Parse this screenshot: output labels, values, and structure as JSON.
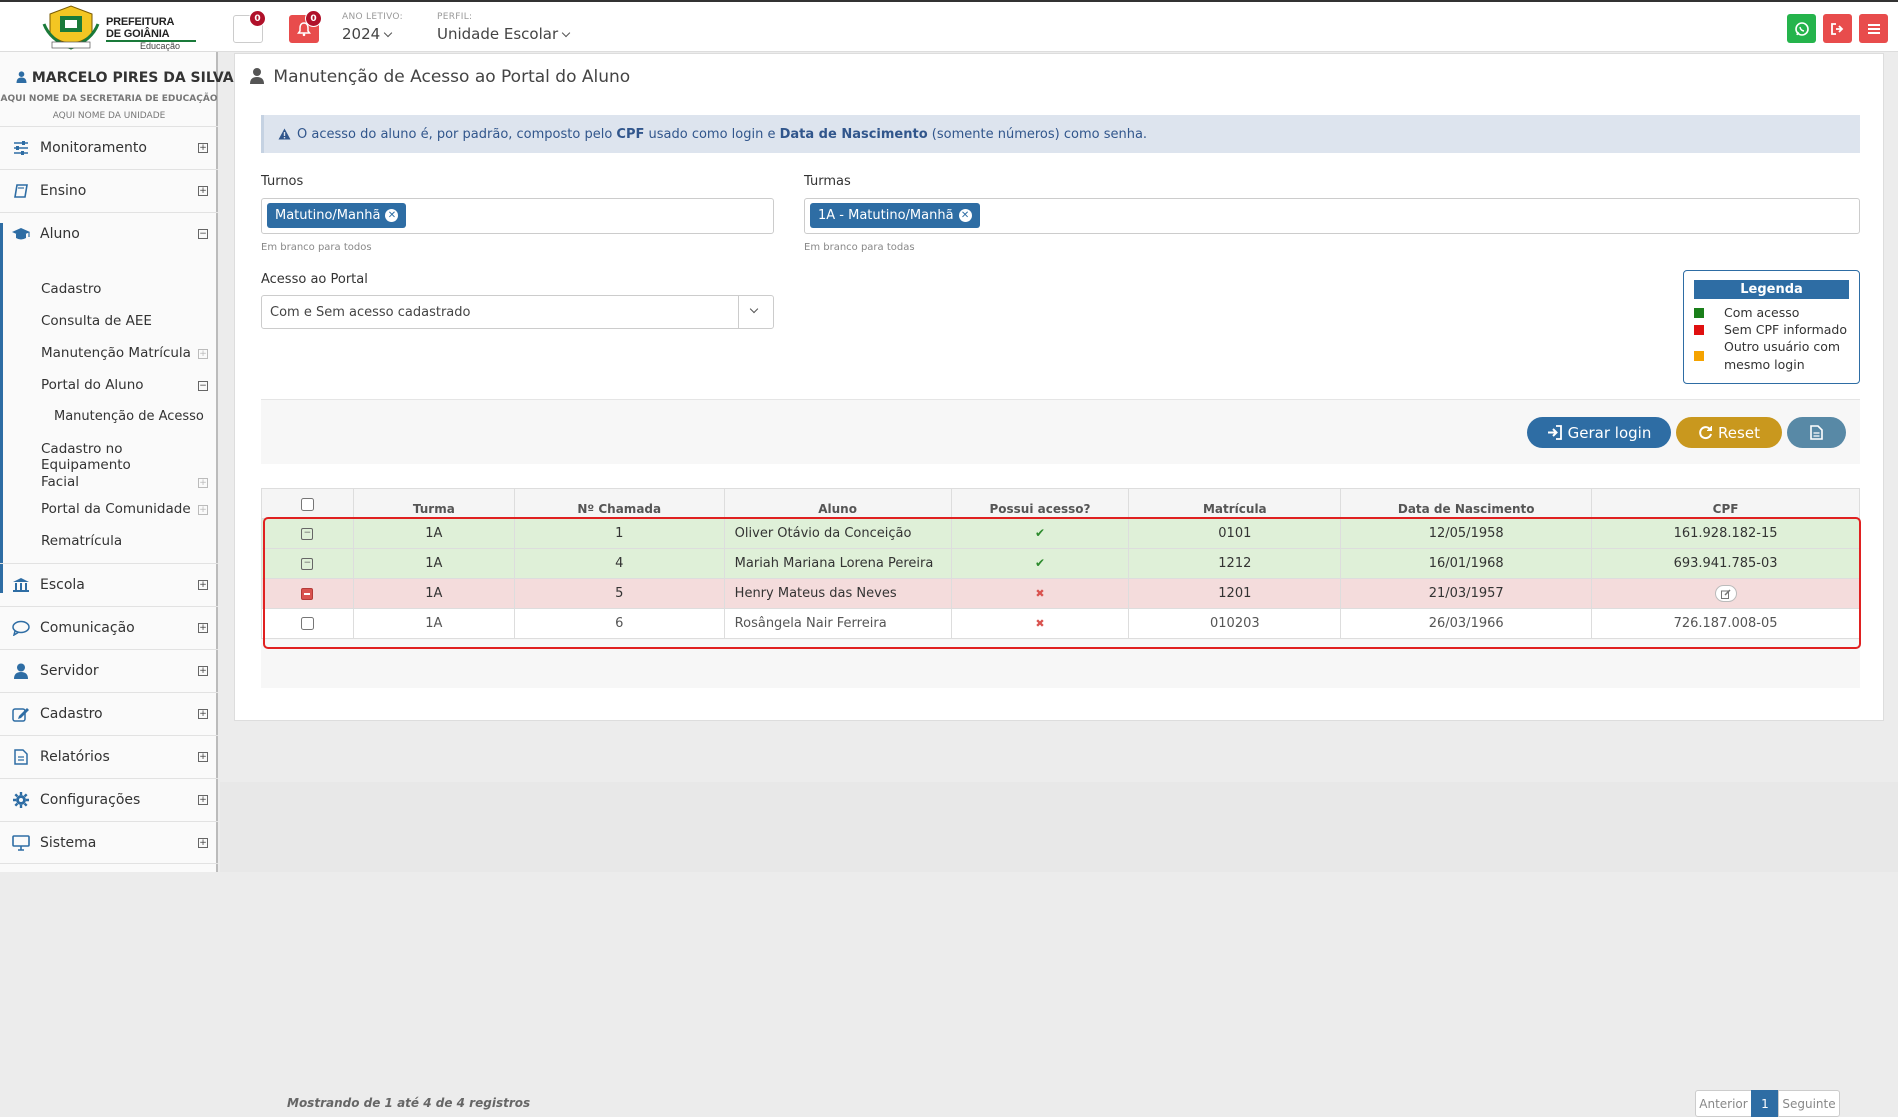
{
  "header": {
    "logo_line1": "PREFEITURA",
    "logo_line2": "DE GOIÂNIA",
    "logo_line3": "Educação",
    "notifications_count": "0",
    "alerts_count": "0",
    "ano_label": "ANO LETIVO:",
    "ano_value": "2024",
    "perfil_label": "PERFIL:",
    "perfil_value": "Unidade Escolar",
    "whatsapp_color": "#25b44c",
    "exit_color": "#e84c4c",
    "menu_color": "#e84c4c"
  },
  "sidebar": {
    "user": "MARCELO PIRES DA SILVA",
    "secretaria": "AQUI NOME DA SECRETARIA DE EDUCAÇÃO",
    "unidade": "AQUI NOME DA UNIDADE",
    "items": [
      {
        "label": "Monitoramento",
        "icon": "sliders-icon"
      },
      {
        "label": "Ensino",
        "icon": "book-icon"
      },
      {
        "label": "Aluno",
        "icon": "graduation-cap-icon"
      },
      {
        "label": "Escola",
        "icon": "bank-icon"
      },
      {
        "label": "Comunicação",
        "icon": "chat-icon"
      },
      {
        "label": "Servidor",
        "icon": "user-icon"
      },
      {
        "label": "Cadastro",
        "icon": "edit-icon"
      },
      {
        "label": "Relatórios",
        "icon": "file-icon"
      },
      {
        "label": "Configurações",
        "icon": "gear-icon"
      },
      {
        "label": "Sistema",
        "icon": "monitor-icon"
      }
    ],
    "aluno_sub": {
      "cadastro": "Cadastro",
      "consulta_aee": "Consulta de AEE",
      "manutencao_matricula": "Manutenção Matrícula",
      "portal_aluno": "Portal do Aluno",
      "manutencao_acesso": "Manutenção de Acesso",
      "cadastro_equip_l1": "Cadastro no Equipamento",
      "cadastro_equip_l2": "Facial",
      "portal_comunidade": "Portal da Comunidade",
      "rematricula": "Rematrícula"
    }
  },
  "main": {
    "title": "Manutenção de Acesso ao Portal do Aluno",
    "info_pre": "O acesso do aluno é, por padrão, composto pelo ",
    "info_cpf": "CPF",
    "info_mid": " usado como login e ",
    "info_dn": "Data de Nascimento",
    "info_post": " (somente números) como senha.",
    "turnos_label": "Turnos",
    "turnos_tag": "Matutino/Manhã",
    "turnos_help": "Em branco para todos",
    "turmas_label": "Turmas",
    "turmas_tag": "1A - Matutino/Manhã",
    "turmas_help": "Em branco para todas",
    "acesso_label": "Acesso ao Portal",
    "acesso_value": "Com e Sem acesso cadastrado",
    "legend": {
      "title": "Legenda",
      "items": [
        {
          "label": "Com acesso",
          "color": "#1a7f1a"
        },
        {
          "label": "Sem CPF informado",
          "color": "#e01010"
        },
        {
          "label_l1": "Outro usuário com",
          "label_l2": "mesmo login",
          "color": "#f5a300"
        }
      ]
    },
    "buttons": {
      "gerar": "Gerar login",
      "reset": "Reset",
      "gerar_color": "#2e6da4",
      "reset_color": "#c9981e",
      "doc_color": "#5889a6"
    },
    "table": {
      "headers": [
        "Turma",
        "Nº Chamada",
        "Aluno",
        "Possui acesso?",
        "Matrícula",
        "Data de Nascimento",
        "CPF"
      ],
      "rows": [
        {
          "turma": "1A",
          "chamada": "1",
          "aluno": "Oliver Otávio da Conceição",
          "acesso": "✔",
          "matricula": "0101",
          "nascimento": "12/05/1958",
          "cpf": "161.928.182-15"
        },
        {
          "turma": "1A",
          "chamada": "4",
          "aluno": "Mariah Mariana Lorena Pereira",
          "acesso": "✔",
          "matricula": "1212",
          "nascimento": "16/01/1968",
          "cpf": "693.941.785-03"
        },
        {
          "turma": "1A",
          "chamada": "5",
          "aluno": "Henry Mateus das Neves",
          "acesso": "✖",
          "matricula": "1201",
          "nascimento": "21/03/1957",
          "cpf": ""
        },
        {
          "turma": "1A",
          "chamada": "6",
          "aluno": "Rosângela Nair Ferreira",
          "acesso": "✖",
          "matricula": "010203",
          "nascimento": "26/03/1966",
          "cpf": "726.187.008-05"
        }
      ]
    },
    "showing": "Mostrando de 1 até 4 de 4 registros",
    "pager": {
      "prev": "Anterior",
      "page": "1",
      "next": "Seguinte"
    }
  }
}
